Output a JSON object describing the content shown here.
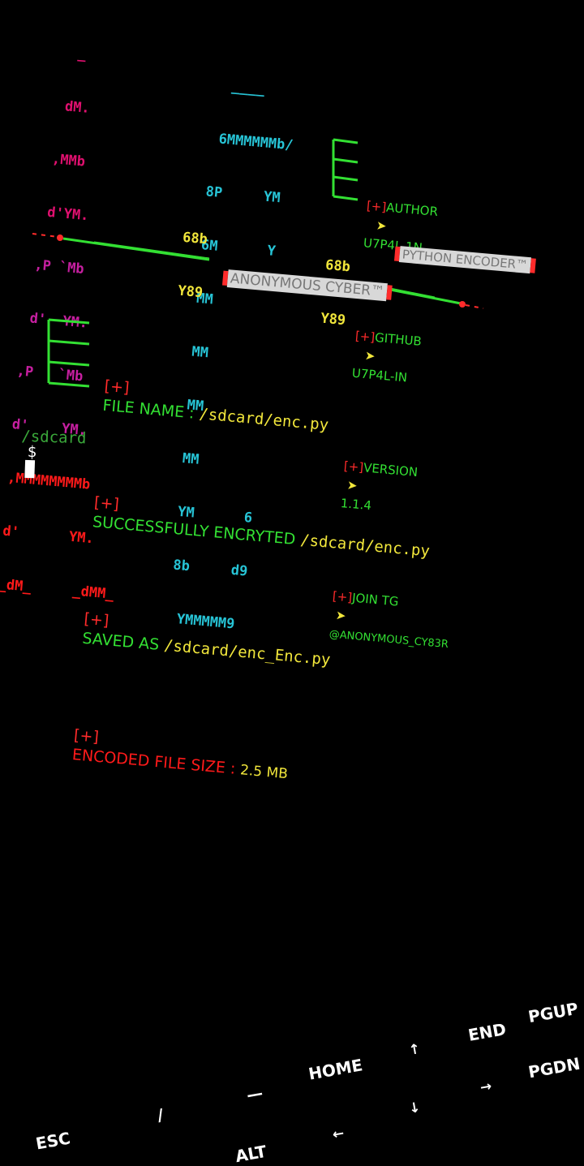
{
  "ascii_art": {
    "a_lines": [
      "    _",
      "   dM.",
      "  ,MMb",
      "  d'YM.",
      " ,P `Mb",
      " d'  YM.",
      ",P   `Mb",
      "d'    YM.",
      ",MMMMMMMMb",
      "d'      YM.",
      "_dM_     _dMM_"
    ],
    "c_lines": [
      "  ____",
      " 6MMMMMMb/",
      "8P     YM",
      "6M      Y",
      "MM",
      "MM",
      "MM",
      "MM",
      "YM      6",
      "8b     d9",
      " YMMMMM9"
    ],
    "small_left": [
      "68b",
      "Y89"
    ],
    "small_right": [
      "68b",
      "Y89"
    ]
  },
  "info": {
    "items": [
      {
        "label": "AUTHOR",
        "value": "U7P4L 1N"
      },
      {
        "label": "GITHUB",
        "value": "U7P4L-IN"
      },
      {
        "label": "VERSION",
        "value": "1.1.4"
      },
      {
        "label": "JOIN TG",
        "value": "@ANONYMOUS_CY83R"
      }
    ],
    "marker": "[+]",
    "arrow": "➤"
  },
  "badges": {
    "python_encoder": "PYTHON ENCODER™",
    "anonymous_cyber": "ANONYMOUS CYBER™"
  },
  "status": {
    "marker": "[+]",
    "lines": [
      {
        "label": "FILE NAME : ",
        "value": "/sdcard/enc.py"
      },
      {
        "label": "SUCCESSFULLY ENCRYTED ",
        "value": "/sdcard/enc.py"
      },
      {
        "label": "SAVED AS ",
        "value": "/sdcard/enc_Enc.py"
      },
      {
        "label": "ENCODED FILE SIZE : ",
        "value": "2.5 MB"
      }
    ]
  },
  "prompt": {
    "path": "/sdcard",
    "symbol": "$"
  },
  "extra_keys": {
    "esc": "ESC",
    "slash": "/",
    "dash": "—",
    "home": "HOME",
    "up": "↑",
    "end": "END",
    "pgup": "PGUP",
    "alt": "ALT",
    "left": "←",
    "down": "↓",
    "right": "→",
    "pgdn": "PGDN"
  },
  "colors": {
    "background": "#000000",
    "accent_green": "#33e033",
    "accent_red": "#ff1a1a",
    "accent_yellow": "#f1e63b",
    "accent_cyan": "#27c4d6"
  }
}
